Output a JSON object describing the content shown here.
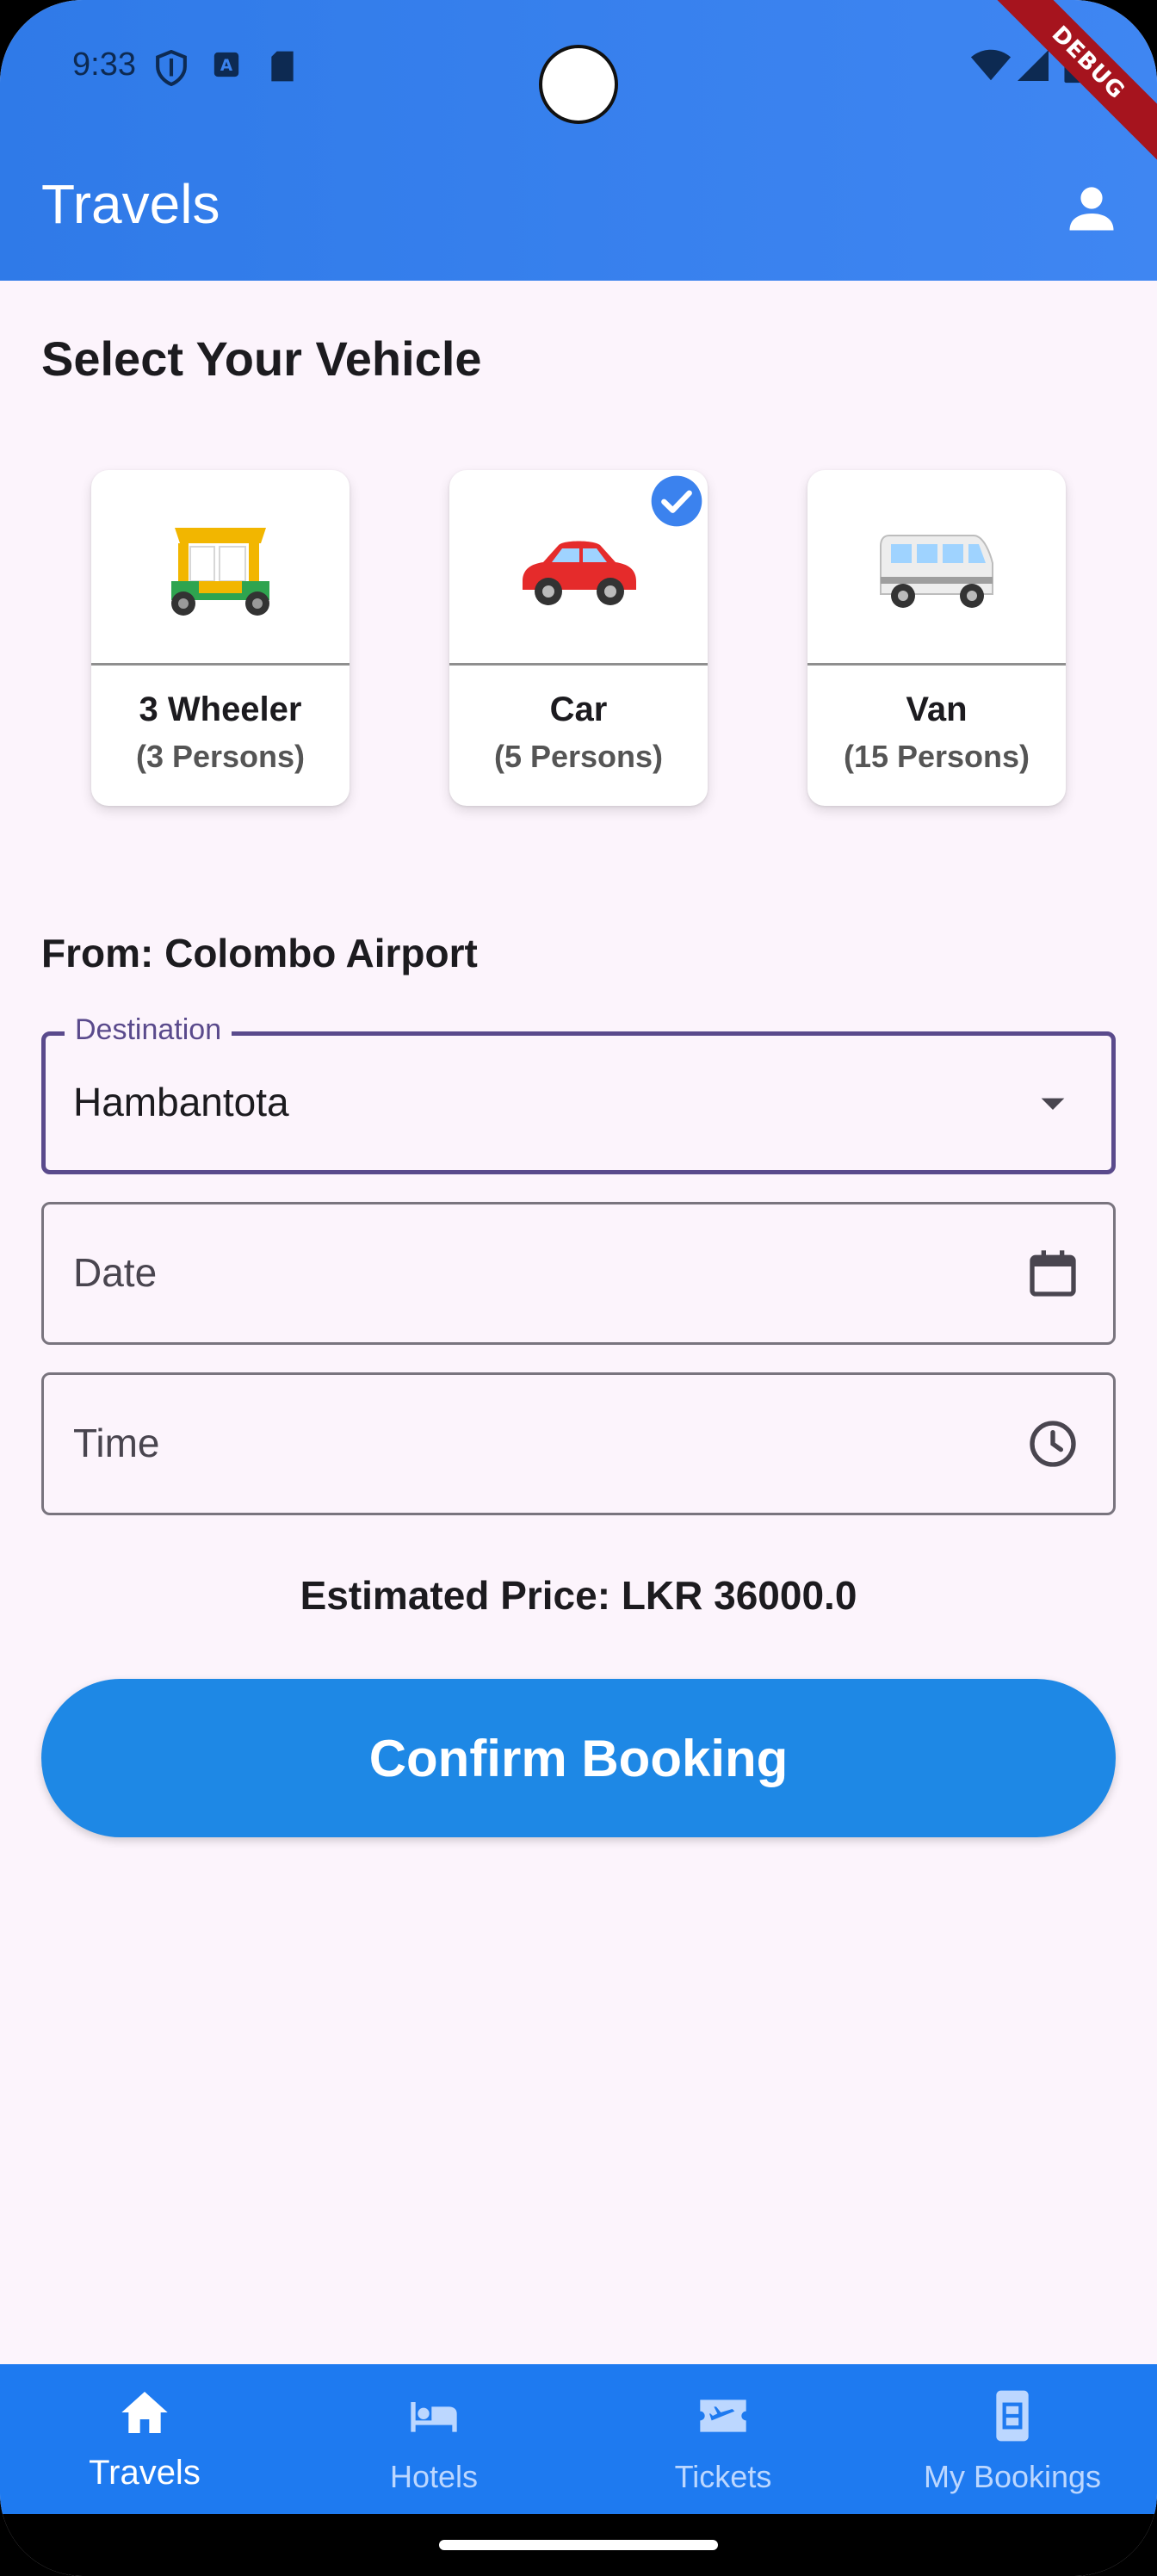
{
  "status_bar": {
    "time": "9:33",
    "debug_banner": "DEBUG"
  },
  "app_bar": {
    "title": "Travels",
    "profile_icon": "person-icon",
    "color": "#3a82ee"
  },
  "vehicle_section": {
    "title": "Select Your Vehicle",
    "vehicles": [
      {
        "name": "3 Wheeler",
        "capacity": "(3 Persons)",
        "icon": "auto-rickshaw-icon",
        "selected": false
      },
      {
        "name": "Car",
        "capacity": "(5 Persons)",
        "icon": "car-icon",
        "selected": true
      },
      {
        "name": "Van",
        "capacity": "(15 Persons)",
        "icon": "van-icon",
        "selected": false
      }
    ]
  },
  "booking_form": {
    "from_label": "From: Colombo Airport",
    "destination": {
      "label": "Destination",
      "value": "Hambantota"
    },
    "date": {
      "placeholder": "Date",
      "icon": "calendar-icon"
    },
    "time": {
      "placeholder": "Time",
      "icon": "clock-icon"
    },
    "estimated_price": "Estimated Price: LKR 36000.0",
    "confirm_label": "Confirm Booking",
    "accent_color": "#1e88e5"
  },
  "bottom_nav": {
    "items": [
      {
        "label": "Travels",
        "icon": "home-icon",
        "active": true
      },
      {
        "label": "Hotels",
        "icon": "bed-icon",
        "active": false
      },
      {
        "label": "Tickets",
        "icon": "plane-ticket-icon",
        "active": false
      },
      {
        "label": "My Bookings",
        "icon": "bookings-icon",
        "active": false
      }
    ]
  }
}
